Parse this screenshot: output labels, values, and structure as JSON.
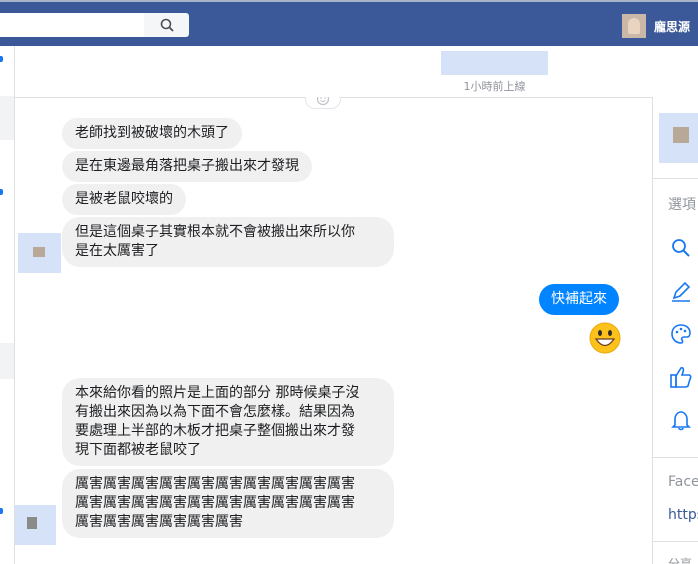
{
  "topbar": {
    "search_placeholder": "",
    "search_icon": "search-icon",
    "user_name": "龐思源"
  },
  "chat_header": {
    "status": "1小時前上線"
  },
  "messages_group1": [
    "老師找到被破壞的木頭了",
    "是在東邊最角落把桌子搬出來才發現",
    "是被老鼠咬壞的",
    "但是這個桌子其實根本就不會被搬出來所以你\n是在太厲害了"
  ],
  "outgoing": {
    "text": "快補起來",
    "emoji": "grinning-face-emoji"
  },
  "messages_group2": [
    "本來給你看的照片是上面的部分 那時候桌子沒\n有搬出來因為以為下面不會怎麼樣。結果因為\n要處理上半部的木板才把桌子整個搬出來才發\n現下面都被老鼠咬了",
    "厲害厲害厲害厲害厲害厲害厲害厲害厲害厲害\n厲害厲害厲害厲害厲害厲害厲害厲害厲害厲害\n厲害厲害厲害厲害厲害厲害"
  ],
  "right_panel": {
    "options_label": "選項",
    "icons": [
      "search-icon",
      "pencil-icon",
      "palette-icon",
      "thumbs-up-icon",
      "bell-icon"
    ],
    "section_label": "Face",
    "link_text": "https",
    "bottom_label": "分享"
  },
  "colors": {
    "topbar": "#3b5998",
    "outgoing_bubble": "#0084ff",
    "incoming_bubble": "#f1f0f0",
    "accent": "#1877f2"
  }
}
